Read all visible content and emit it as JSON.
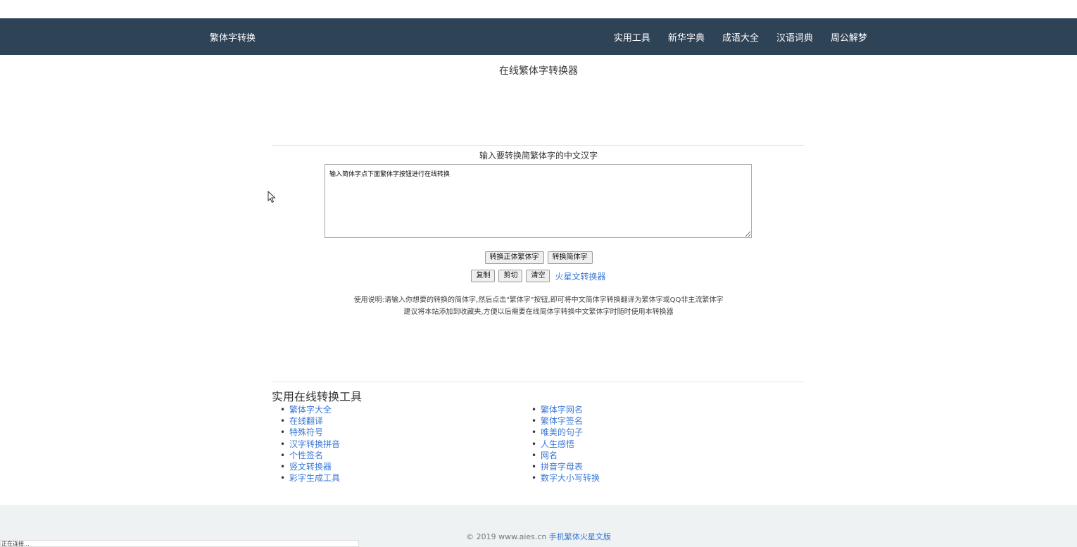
{
  "nav": {
    "brand": "繁体字转换",
    "links": [
      "实用工具",
      "新华字典",
      "成语大全",
      "汉语词典",
      "周公解梦"
    ]
  },
  "page_title": "在线繁体字转换器",
  "converter": {
    "label": "输入要转换简繁体字的中文汉字",
    "textarea_value": "输入简体字点下面繁体字按钮进行在线转换",
    "buttons": {
      "to_traditional": "转换正体繁体字",
      "to_simplified": "转换简体字",
      "copy": "复制",
      "cut": "剪切",
      "clear": "清空"
    },
    "mars_link": "火星文转换器"
  },
  "instructions": {
    "line1": "使用说明:请输入你想要的转换的简体字,然后点击\"繁体字\"按钮,即可将中文简体字转换翻译为繁体字或QQ非主流繁体字",
    "line2": "建议将本站添加到收藏夹,方便以后需要在线简体字转换中文繁体字时随时使用本转换器"
  },
  "tools": {
    "title": "实用在线转换工具",
    "left": [
      "繁体字大全",
      "在线翻译",
      "特殊符号",
      "汉字转换拼音",
      "个性签名",
      "竖文转换器",
      "彩字生成工具"
    ],
    "right": [
      "繁体字网名",
      "繁体字签名",
      "唯美的句子",
      "人生感悟",
      "网名",
      "拼音字母表",
      "数字大小写转换"
    ]
  },
  "footer": {
    "copyright": "© 2019 www.aies.cn",
    "mobile_link": "手机繁体火星文版"
  },
  "statusbar": {
    "text": "正在连接..."
  },
  "colors": {
    "nav_bg": "#2f4357",
    "link": "#3a78d6",
    "footer_bg": "#eef2f3"
  }
}
